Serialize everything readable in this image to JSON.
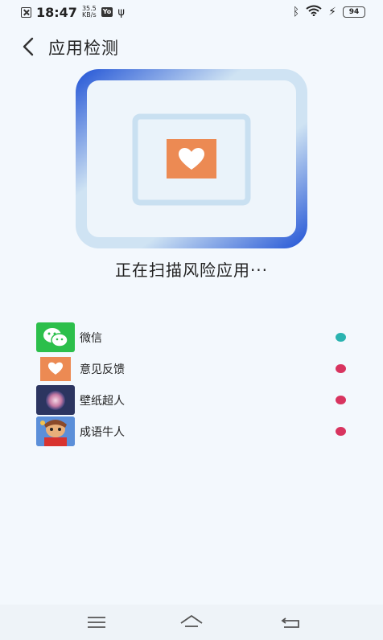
{
  "status_bar": {
    "time": "18:47",
    "speed_value": "35.5",
    "speed_unit": "KB/s",
    "badge": "Yo",
    "battery": "94"
  },
  "header": {
    "title": "应用检测"
  },
  "scan": {
    "status_text": "正在扫描风险应用···"
  },
  "apps": [
    {
      "name": "微信",
      "status_color": "#2ab3b0",
      "icon": "wechat-icon",
      "icon_bg": "#2cbf4b"
    },
    {
      "name": "意见反馈",
      "status_color": "#d8345f",
      "icon": "heart-icon",
      "icon_bg": "#ec8a53"
    },
    {
      "name": "壁纸超人",
      "status_color": "#d8345f",
      "icon": "wallpaper-icon",
      "icon_bg": "#2c3560"
    },
    {
      "name": "成语牛人",
      "status_color": "#d8345f",
      "icon": "idiom-game-icon",
      "icon_bg": "#4a7fcf"
    }
  ],
  "colors": {
    "accent_blue": "#2f5fd8",
    "frame_light": "#cfe3f3",
    "logo_orange": "#ec8a53"
  }
}
